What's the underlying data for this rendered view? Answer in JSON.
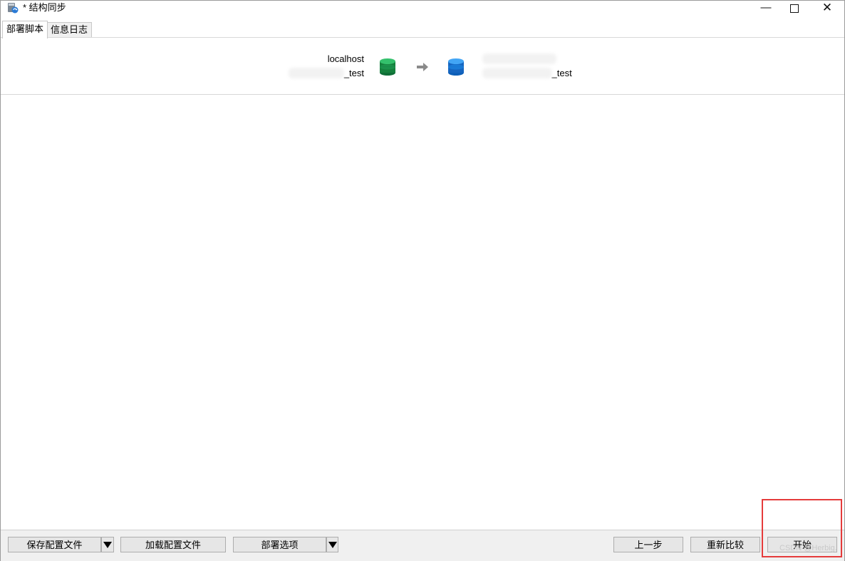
{
  "window": {
    "title": "* 结构同步",
    "minimize_glyph": "—",
    "close_glyph": "✕"
  },
  "tabs": [
    {
      "label": "部署脚本",
      "active": true
    },
    {
      "label": "信息日志",
      "active": false
    }
  ],
  "source": {
    "host": "localhost",
    "database": "_test",
    "icon": "database-green-icon",
    "color": "#1f9d55"
  },
  "target": {
    "host": "",
    "database": "_test",
    "icon": "database-blue-icon",
    "color": "#1e88e5"
  },
  "arrow_icon": "arrow-right-icon",
  "toolbar": {
    "save_config": "保存配置文件",
    "load_config": "加载配置文件",
    "deploy_options": "部署选项",
    "prev_step": "上一步",
    "recompare": "重新比较",
    "start": "开始"
  },
  "highlight_color": "#e53b3b",
  "watermark": "CSDN @Herbig."
}
